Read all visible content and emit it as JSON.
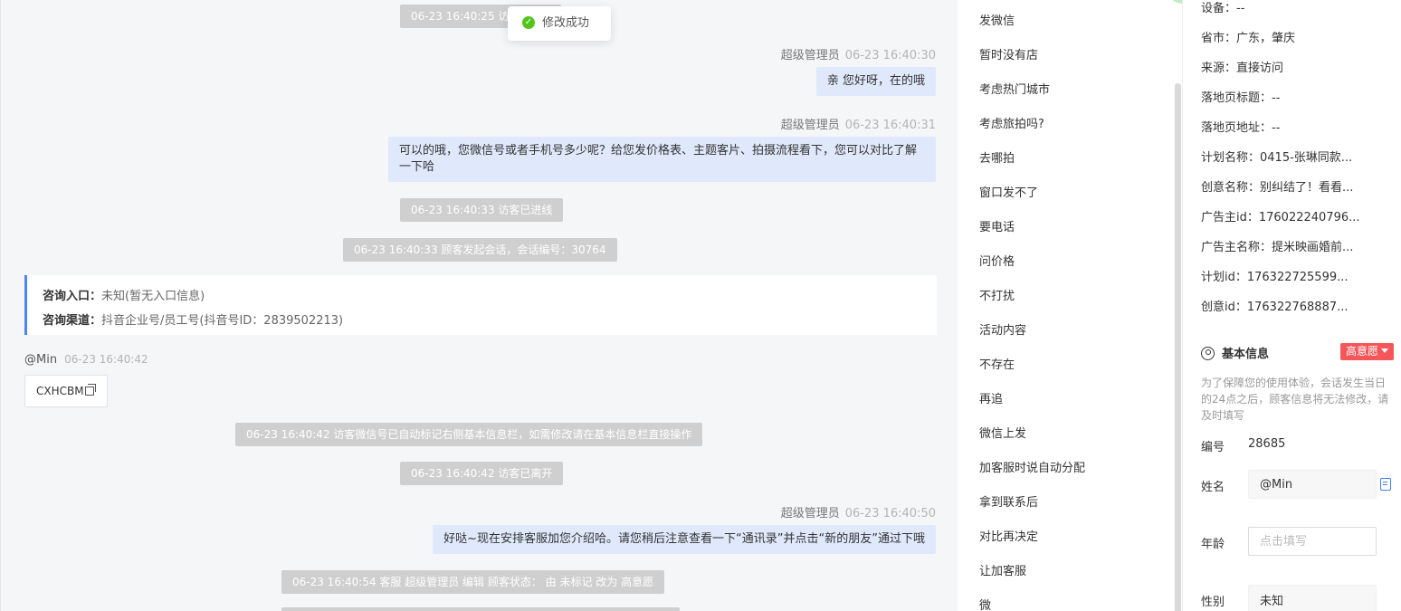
{
  "toast": {
    "text": "修改成功"
  },
  "chat": {
    "sys_top": "06-23 16:40:25 访客",
    "msg1": {
      "sender": "超级管理员",
      "time": "06-23 16:40:30",
      "text": "亲 您好呀，在的哦"
    },
    "msg2": {
      "sender": "超级管理员",
      "time": "06-23 16:40:31",
      "line1": "可以的哦，您微信号或者手机号多少呢？给您发价格表、主题客片、拍摄流程看下，您可以对比了解",
      "line2": "一下哈"
    },
    "sys_enter": "06-23 16:40:33 访客已进线",
    "sys_session": "06-23 16:40:33 顾客发起会话，会话编号：30764",
    "entry_card": {
      "label1": "咨询入口：",
      "value1": "未知(暂无入口信息)",
      "label2": "咨询渠道：",
      "value2": "抖音企业号/员工号(抖音号ID：2839502213)"
    },
    "visitor": {
      "name": "@Min",
      "time": "06-23 16:40:42",
      "code": "CXHCBM"
    },
    "sys_wechat": "06-23 16:40:42 访客微信号已自动标记右侧基本信息栏，如需修改请在基本信息栏直接操作",
    "sys_leave": "06-23 16:40:42 访客已离开",
    "msg3": {
      "sender": "超级管理员",
      "time": "06-23 16:40:50",
      "text": "好哒~现在安排客服加您介绍哈。请您稍后注意查看一下“通讯录”并点击“新的朋友”通过下哦"
    },
    "sys_edit": "06-23 16:40:54 客服 超级管理员 编辑 顾客状态：  由 未标记 改为 高意愿"
  },
  "quick_replies": [
    "发微信",
    "暂时没有店",
    "考虑热门城市",
    "考虑旅拍吗?",
    "去哪拍",
    "窗口发不了",
    "要电话",
    "问价格",
    "不打扰",
    "活动内容",
    "不存在",
    "再追",
    "微信上发",
    "加客服时说自动分配",
    "拿到联系后",
    "对比再决定",
    "让加客服",
    "微"
  ],
  "info": {
    "rows": [
      "设备：--",
      "省市：广东，肇庆",
      "来源：直接访问",
      "落地页标题：--",
      "落地页地址：--",
      "计划名称：0415-张琳同款...",
      "创意名称：别纠结了！看看...",
      "广告主id：176022240796...",
      "广告主名称：提米映画婚前...",
      "计划id：176322725599...",
      "创意id：176322768887..."
    ],
    "section_title": "基本信息",
    "intent_badge": "高意愿",
    "notice": "为了保障您的使用体验，会话发生当日的24点之后，顾客信息将无法修改，请及时填写",
    "fields": {
      "id_label": "编号",
      "id_value": "28685",
      "name_label": "姓名",
      "name_value": "@Min",
      "age_label": "年龄",
      "age_placeholder": "点击填写",
      "gender_label": "性别",
      "gender_value": "未知"
    }
  }
}
